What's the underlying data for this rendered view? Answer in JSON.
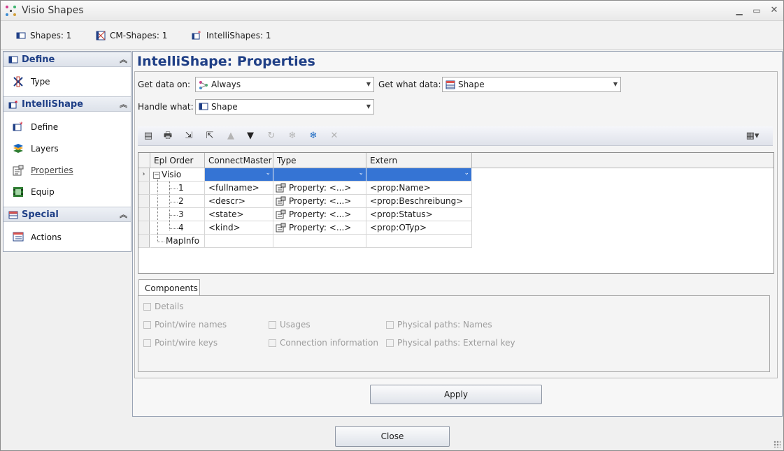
{
  "window": {
    "title": "Visio Shapes"
  },
  "counts": [
    {
      "label": "Shapes: 1",
      "icon": "shape-icon"
    },
    {
      "label": "CM-Shapes: 1",
      "icon": "cm-shapes-icon"
    },
    {
      "label": "IntelliShapes: 1",
      "icon": "intellishape-icon"
    }
  ],
  "nav": {
    "groups": [
      {
        "title": "Define",
        "items": [
          {
            "label": "Type",
            "icon": "type-icon"
          }
        ]
      },
      {
        "title": "IntelliShape",
        "items": [
          {
            "label": "Define",
            "icon": "define-icon"
          },
          {
            "label": "Layers",
            "icon": "layers-icon"
          },
          {
            "label": "Properties",
            "icon": "properties-icon",
            "active": true
          },
          {
            "label": "Equip",
            "icon": "equip-icon"
          }
        ]
      },
      {
        "title": "Special",
        "items": [
          {
            "label": "Actions",
            "icon": "actions-icon"
          }
        ]
      }
    ]
  },
  "main": {
    "title": "IntelliShape:  Properties",
    "get_data_on": {
      "label": "Get data on:",
      "value": "Always"
    },
    "get_what_data": {
      "label": "Get what data:",
      "value": "Shape"
    },
    "handle_what": {
      "label": "Handle what:",
      "value": "Shape"
    },
    "grid": {
      "columns": [
        "Epl Order",
        "ConnectMaster",
        "Type",
        "Extern"
      ],
      "parent": "Visio",
      "rows": [
        {
          "order": "1",
          "connect": "<fullname>",
          "type": "Property: <...>",
          "extern": "<prop:Name>"
        },
        {
          "order": "2",
          "connect": "<descr>",
          "type": "Property: <...>",
          "extern": "<prop:Beschreibung>"
        },
        {
          "order": "3",
          "connect": "<state>",
          "type": "Property: <...>",
          "extern": "<prop:Status>"
        },
        {
          "order": "4",
          "connect": "<kind>",
          "type": "Property: <...>",
          "extern": "<prop:OTyp>"
        }
      ],
      "extra_row": "MapInfo"
    },
    "components": {
      "tab": "Components",
      "details": "Details",
      "point_wire_names": "Point/wire names",
      "point_wire_keys": "Point/wire keys",
      "usages": "Usages",
      "connection_information": "Connection information",
      "physical_paths_names": "Physical paths: Names",
      "physical_paths_external_key": "Physical paths: External key"
    },
    "apply": "Apply"
  },
  "footer": {
    "close": "Close"
  },
  "colors": {
    "accent": "#1f3f86",
    "selection": "#3574d4"
  }
}
